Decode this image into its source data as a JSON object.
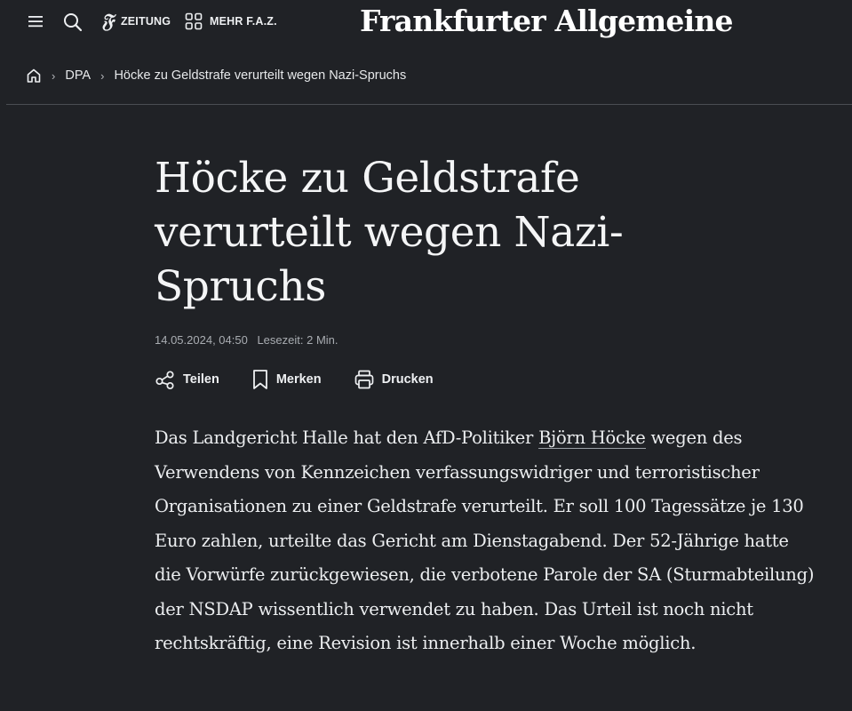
{
  "header": {
    "menu_icon": "hamburger-menu-icon",
    "search_icon": "search-icon",
    "zeitung_label": "ZEITUNG",
    "mehr_label": "MEHR F.A.Z.",
    "logo_text": "Frankfurter Allgemeine"
  },
  "breadcrumb": {
    "home_icon": "home-icon",
    "items": [
      "DPA",
      "Höcke zu Geldstrafe verurteilt wegen Nazi-Spruchs"
    ]
  },
  "article": {
    "headline": "Höcke zu Geldstrafe verurteilt wegen Nazi-Spruchs",
    "date": "14.05.2024, 04:50",
    "reading_time": "Lesezeit: 2 Min.",
    "actions": {
      "share": "Teilen",
      "bookmark": "Merken",
      "print": "Drucken"
    },
    "body_before_link": "Das Landgericht Halle hat den AfD-Politiker ",
    "body_link": "Björn Höcke",
    "body_after_link": " wegen des Verwendens von Kennzeichen verfassungswidriger und terroristischer Organisationen zu einer Geldstrafe verurteilt. Er soll 100 Tagessätze je 130 Euro zahlen, urteilte das Gericht am Dienstagabend. Der 52-Jährige hatte die Vorwürfe zurückgewiesen, die verbotene Parole der SA (Sturmabteilung) der NSDAP wissentlich verwendet zu haben. Das Urteil ist noch nicht rechtskräftig, eine Revision ist innerhalb einer Woche möglich."
  },
  "colors": {
    "background": "#202226",
    "text": "#eef0f2",
    "muted": "#a9adb2",
    "divider": "#4a4d52"
  }
}
